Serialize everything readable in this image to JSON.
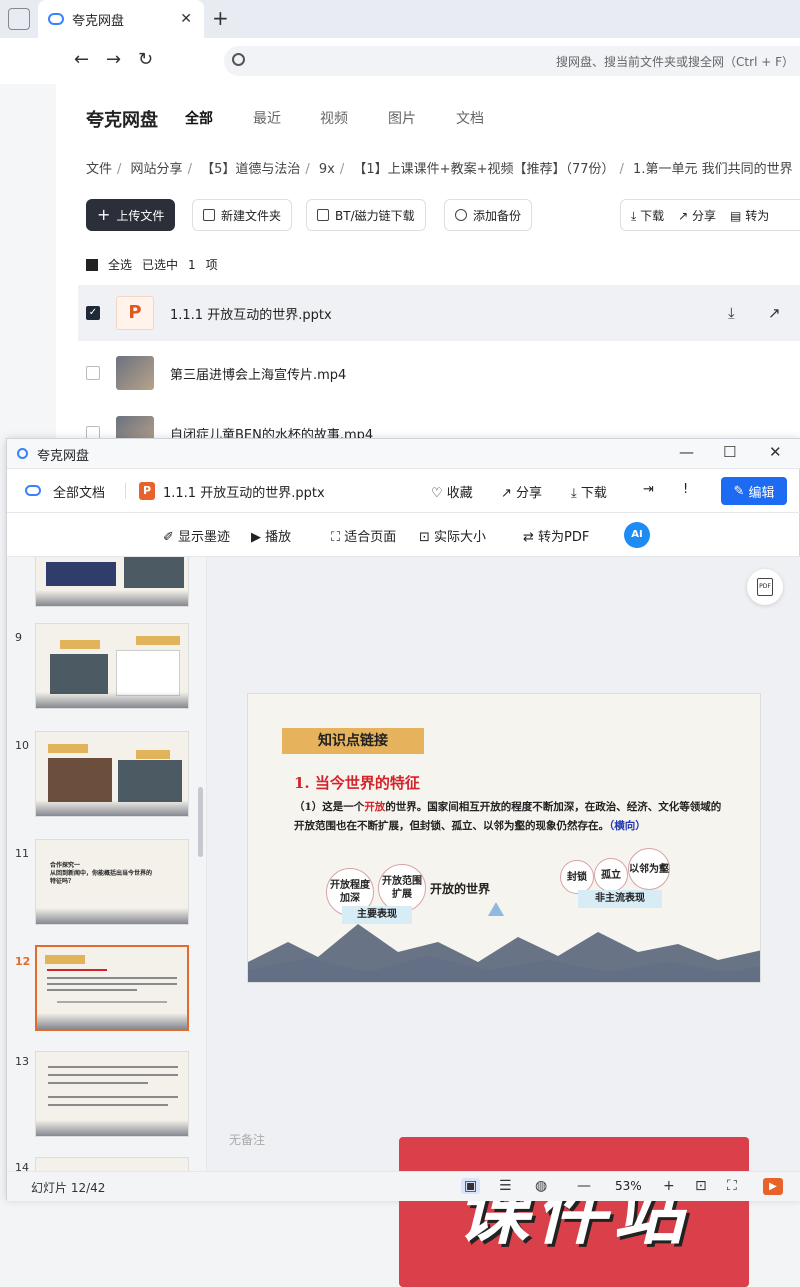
{
  "browser": {
    "tab_title": "夸克网盘",
    "new_tab": "+",
    "close": "✕",
    "search_placeholder": "搜网盘、搜当前文件夹或搜全网（Ctrl + F）"
  },
  "app": {
    "brand": "夸克网盘",
    "categories": [
      "全部",
      "最近",
      "视频",
      "图片",
      "文档"
    ],
    "breadcrumb": [
      "文件",
      "网站分享",
      "【5】道德与法治",
      "9x",
      "【1】上课课件+教案+视频【推荐】（77份）",
      "1.第一单元 我们共同的世界"
    ],
    "actions": {
      "upload": "上传文件",
      "new_folder": "新建文件夹",
      "bt": "BT/磁力链下载",
      "backup": "添加备份",
      "download": "下载",
      "share": "分享",
      "convert": "转为"
    },
    "select_all": "全选",
    "selected_prefix": "已选中",
    "selected_count": "1",
    "selected_suffix": "项",
    "files": [
      {
        "name": "1.1.1 开放互动的世界.pptx"
      },
      {
        "name": "第三届进博会上海宣传片.mp4"
      },
      {
        "name": "自闭症儿童BEN的水杯的故事.mp4"
      }
    ]
  },
  "viewer": {
    "title": "夸克网盘",
    "all_docs": "全部文档",
    "doc_name": "1.1.1 开放互动的世界.pptx",
    "top_actions": {
      "fav": "收藏",
      "share": "分享",
      "download": "下载",
      "edit": "编辑"
    },
    "tools": {
      "ink": "显示墨迹",
      "play": "播放",
      "fit": "适合页面",
      "actual": "实际大小",
      "pdf": "转为PDF",
      "ai": "AI"
    },
    "slide_numbers": [
      "9",
      "10",
      "11",
      "12",
      "13",
      "14"
    ],
    "thumb_texts": {
      "t11_line1": "合作探究一",
      "t11_line2": "从回到新闻中，你能概括出当今世界的",
      "t11_line3": "特征吗？"
    },
    "slide": {
      "tag": "知识点链接",
      "heading": "1. 当今世界的特征",
      "body_1": "（1）这是一个",
      "body_red": "开放",
      "body_2": "的世界。国家间相互开放的程度不断加深，在政治、经济、文化等领域的开放范围也在不断扩展，但封锁、孤立、以邻为壑的现象仍然存在。",
      "body_blue": "（横向）",
      "bubble_1": "开放程度加深",
      "bubble_2": "开放范围扩展",
      "main_label": "主要表现",
      "center": "开放的世界",
      "bubble_3": "封锁",
      "bubble_4": "孤立",
      "bubble_5": "以邻为壑",
      "non_main_label": "非主流表现"
    },
    "watermark": "课件站",
    "no_notes": "无备注",
    "status": {
      "slide_count": "幻灯片 12/42",
      "zoom": "53%"
    }
  }
}
